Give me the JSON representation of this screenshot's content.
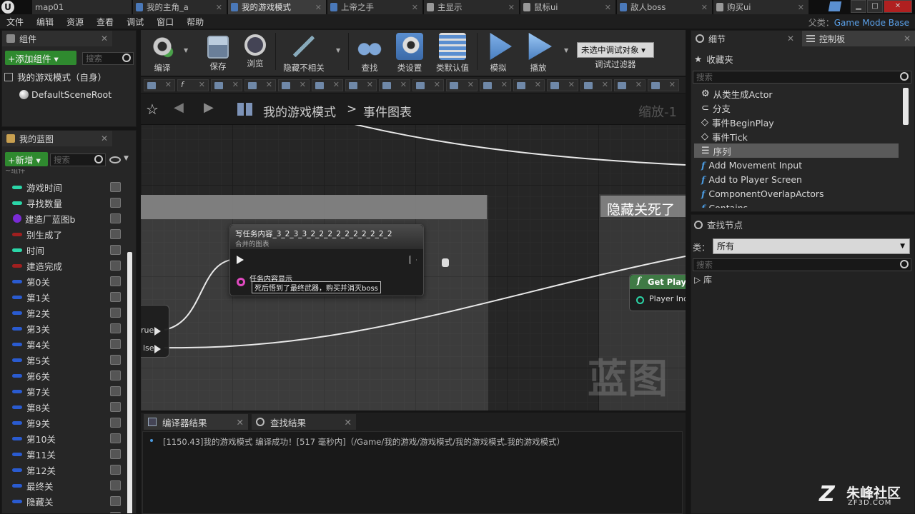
{
  "window": {
    "tabs": [
      {
        "label": "map01",
        "active": false
      },
      {
        "label": "我的主角_a",
        "active": false
      },
      {
        "label": "我的游戏模式",
        "active": true
      },
      {
        "label": "上帝之手",
        "active": false
      },
      {
        "label": "主显示",
        "active": false
      },
      {
        "label": "鼠标ui",
        "active": false
      },
      {
        "label": "敌人boss",
        "active": false
      },
      {
        "label": "购买ui",
        "active": false
      }
    ],
    "minimize": "▁",
    "maximize": "□",
    "close": "✕"
  },
  "menu": {
    "items": [
      "文件",
      "编辑",
      "资源",
      "查看",
      "调试",
      "窗口",
      "帮助"
    ],
    "parent_label": "父类：",
    "parent_value": "Game Mode Base"
  },
  "components": {
    "tab_title": "组件",
    "add_button": "+添加组件 ▾",
    "search_placeholder": "搜索",
    "self_item": "我的游戏模式（自身）",
    "root_item": "DefaultSceneRoot"
  },
  "myblueprint": {
    "tab_title": "我的蓝图",
    "new_button": "+新增 ▾",
    "search_placeholder": "搜索",
    "partial_header": "~组件",
    "variables": [
      {
        "name": "游戏时间",
        "color": "#2bd6a8",
        "shape": "pill"
      },
      {
        "name": "寻找数量",
        "color": "#2bd6a8",
        "shape": "pill"
      },
      {
        "name": "建造厂蓝图b",
        "color": "#7a2bd6",
        "shape": "dot"
      },
      {
        "name": "别生成了",
        "color": "#a01f1f",
        "shape": "pill"
      },
      {
        "name": "时间",
        "color": "#2bd6a8",
        "shape": "pill"
      },
      {
        "name": "建造完成",
        "color": "#a01f1f",
        "shape": "pill"
      },
      {
        "name": "第0关",
        "color": "#2a5bd0",
        "shape": "pill"
      },
      {
        "name": "第1关",
        "color": "#2a5bd0",
        "shape": "pill"
      },
      {
        "name": "第2关",
        "color": "#2a5bd0",
        "shape": "pill"
      },
      {
        "name": "第3关",
        "color": "#2a5bd0",
        "shape": "pill"
      },
      {
        "name": "第4关",
        "color": "#2a5bd0",
        "shape": "pill"
      },
      {
        "name": "第5关",
        "color": "#2a5bd0",
        "shape": "pill"
      },
      {
        "name": "第6关",
        "color": "#2a5bd0",
        "shape": "pill"
      },
      {
        "name": "第7关",
        "color": "#2a5bd0",
        "shape": "pill"
      },
      {
        "name": "第8关",
        "color": "#2a5bd0",
        "shape": "pill"
      },
      {
        "name": "第9关",
        "color": "#2a5bd0",
        "shape": "pill"
      },
      {
        "name": "第10关",
        "color": "#2a5bd0",
        "shape": "pill"
      },
      {
        "name": "第11关",
        "color": "#2a5bd0",
        "shape": "pill"
      },
      {
        "name": "第12关",
        "color": "#2a5bd0",
        "shape": "pill"
      },
      {
        "name": "最终关",
        "color": "#2a5bd0",
        "shape": "pill"
      },
      {
        "name": "隐藏关",
        "color": "#2a5bd0",
        "shape": "pill"
      },
      {
        "name": "...",
        "color": "#2a5bd0",
        "shape": "pill"
      }
    ]
  },
  "toolbar": {
    "buttons": [
      {
        "label": "编译",
        "icon": "compile-gear-icon"
      },
      {
        "label": "保存",
        "icon": "save-disk-icon"
      },
      {
        "label": "浏览",
        "icon": "browse-magnifier-icon"
      },
      {
        "label": "隐藏不相关",
        "icon": "hide-unrelated-icon"
      },
      {
        "label": "查找",
        "icon": "find-binoculars-icon"
      },
      {
        "label": "类设置",
        "icon": "class-settings-gear-icon"
      },
      {
        "label": "类默认值",
        "icon": "class-defaults-checklist-icon"
      },
      {
        "label": "模拟",
        "icon": "simulate-icon"
      },
      {
        "label": "播放",
        "icon": "play-icon"
      }
    ],
    "debug_select": "未选中调试对象 ▾",
    "debug_filter": "调试过滤器"
  },
  "graph": {
    "breadcrumb_root": "我的游戏模式",
    "breadcrumb_sep": ">",
    "breadcrumb_leaf": "事件图表",
    "zoom": "缩放-1",
    "watermark": "蓝图",
    "node_title": "写任务内容_3_2_3_3_2_2_2_2_2_2_2_2_2_2",
    "node_subtitle": "合并的图表",
    "node_pin_label": "任务内容显示",
    "node_pin_value": "死后悟到了最终武器，购买并消灭boss",
    "comment_right": "隐藏关死了",
    "getplayer_title": "Get Player",
    "getplayer_pin": "Player Inde",
    "branch_true": "rue",
    "branch_false": "lse"
  },
  "details": {
    "tab_title": "细节",
    "palette_tab": "控制板",
    "favorites_header": "收藏夹",
    "search_placeholder": "搜索",
    "items": [
      {
        "label": "从类生成Actor",
        "kind": "actor"
      },
      {
        "label": "分支",
        "kind": "branch"
      },
      {
        "label": "事件BeginPlay",
        "kind": "event"
      },
      {
        "label": "事件Tick",
        "kind": "event"
      },
      {
        "label": "序列",
        "kind": "sequence",
        "selected": true
      },
      {
        "label": "Add Movement Input",
        "kind": "function"
      },
      {
        "label": "Add to Player Screen",
        "kind": "function"
      },
      {
        "label": "ComponentOverlapActors",
        "kind": "function"
      },
      {
        "label": "Contains",
        "kind": "function"
      }
    ],
    "find_nodes_header": "查找节点",
    "class_label": "类：",
    "class_value": "所有",
    "search2_placeholder": "搜索",
    "library": "库"
  },
  "bottom": {
    "tab_compiler": "编译器结果",
    "tab_find": "查找结果",
    "log_line": "[1150.43]我的游戏模式 编译成功！[517 毫秒内]（/Game/我的游戏/游戏模式/我的游戏模式.我的游戏模式）"
  },
  "branding": {
    "name": "朱峰社区",
    "url": "ZF3D.COM"
  }
}
